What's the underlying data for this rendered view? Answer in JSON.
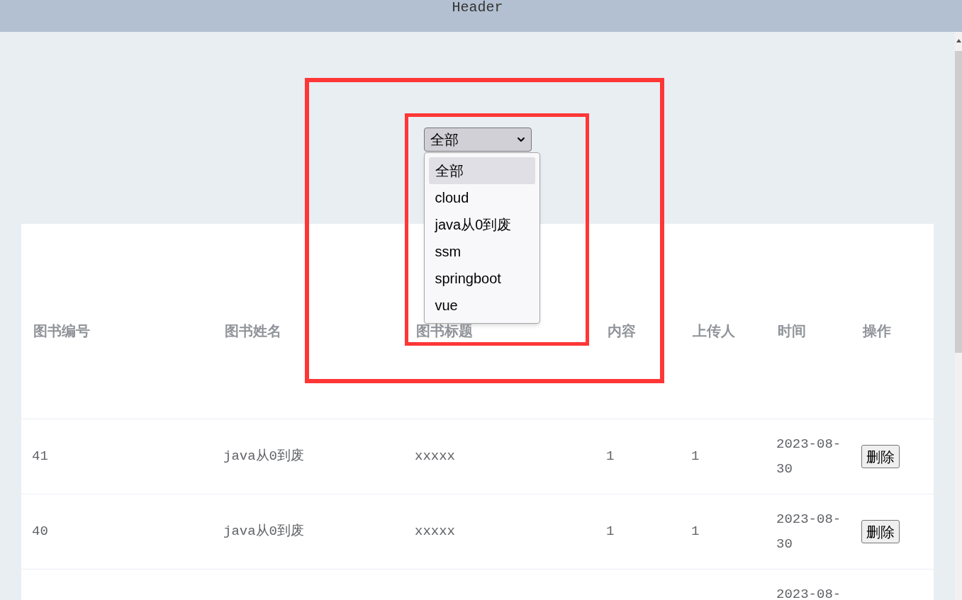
{
  "header": {
    "title": "Header"
  },
  "filter": {
    "value": "全部",
    "expanded": true,
    "options": [
      {
        "label": "全部",
        "selected": true
      },
      {
        "label": "cloud",
        "selected": false
      },
      {
        "label": "java从0到废",
        "selected": false
      },
      {
        "label": "ssm",
        "selected": false
      },
      {
        "label": "springboot",
        "selected": false
      },
      {
        "label": "vue",
        "selected": false
      }
    ]
  },
  "table": {
    "columns": [
      "图书编号",
      "图书姓名",
      "图书标题",
      "内容",
      "上传人",
      "时间",
      "操作"
    ],
    "rows": [
      {
        "id": "41",
        "name": "java从0到废",
        "title": "xxxxx",
        "content": "1",
        "uploader": "1",
        "time": "2023-08-30",
        "action": "删除"
      },
      {
        "id": "40",
        "name": "java从0到废",
        "title": "xxxxx",
        "content": "1",
        "uploader": "1",
        "time": "2023-08-30",
        "action": "删除"
      },
      {
        "time": "2023-08-"
      }
    ]
  }
}
